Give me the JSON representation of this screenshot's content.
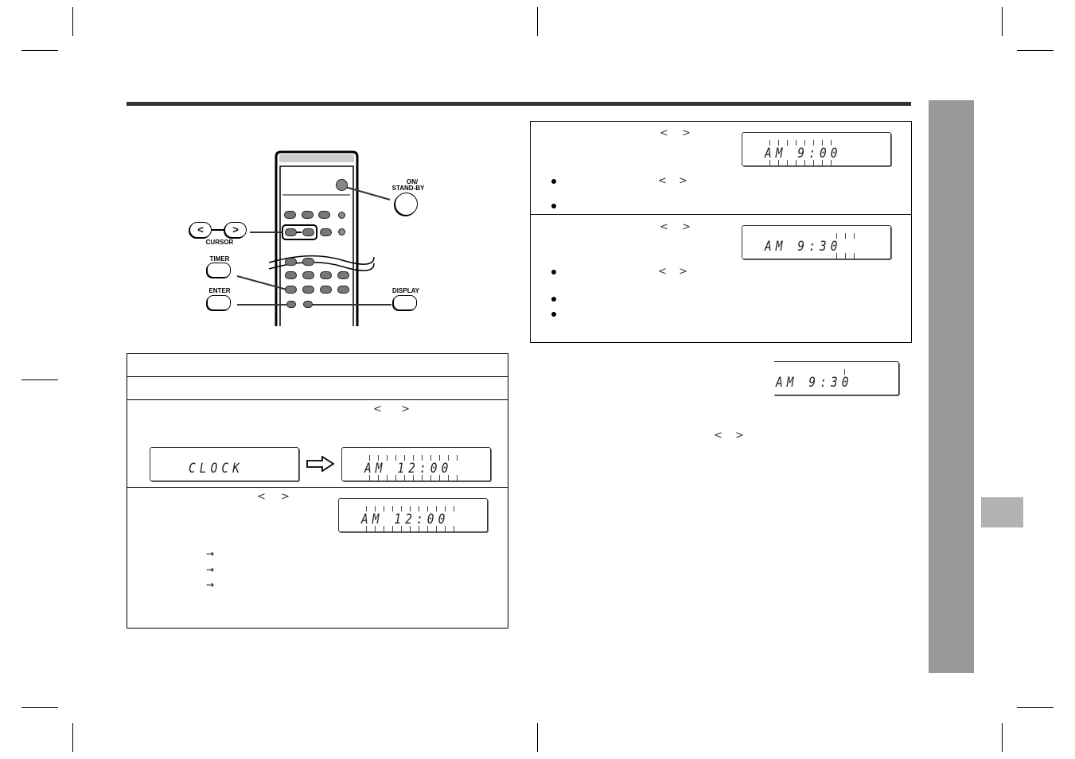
{
  "page": {
    "colors": {
      "header_rule": "#333333",
      "side_tab": "#999999",
      "index_tab": "#b3b3b3",
      "lcd_border": "#333333"
    }
  },
  "remote": {
    "labels": {
      "on_standby": "ON/\nSTAND-BY",
      "on": "ON/",
      "standby": "STAND-BY",
      "cursor": "CURSOR",
      "cursor_left": "<",
      "cursor_right": ">",
      "timer": "TIMER",
      "enter": "ENTER",
      "display": "DISPLAY"
    }
  },
  "left_table": {
    "rows": [
      {
        "text": ""
      },
      {
        "text": ""
      },
      {
        "glyphs": [
          "<",
          ">"
        ],
        "displays": [
          "CLOCK",
          "AM 12:00"
        ],
        "arrow": "⇨"
      },
      {
        "glyphs": [
          "<",
          ">"
        ],
        "display": "AM 12:00",
        "arrows": [
          "→",
          "→",
          "→"
        ]
      }
    ]
  },
  "right_table": {
    "rows": [
      {
        "glyphs": [
          "<",
          ">"
        ],
        "display": "AM 9:00",
        "bullets": [
          {
            "glyphs": [
              "<",
              ">"
            ]
          },
          {
            "glyphs": []
          }
        ]
      },
      {
        "glyphs": [
          "<",
          ">"
        ],
        "display": "AM 9:30",
        "bullets": [
          {
            "glyphs": [
              "<",
              ">"
            ]
          },
          {
            "glyphs": []
          },
          {
            "glyphs": []
          }
        ]
      }
    ]
  },
  "after_table": {
    "display": "AM 9:30",
    "glyphs": [
      "<",
      ">"
    ]
  },
  "lcd": {
    "clock": "CLOCK",
    "am1200": "AM  12:00",
    "am900": "AM   9:00",
    "am930": "AM   9:30"
  }
}
